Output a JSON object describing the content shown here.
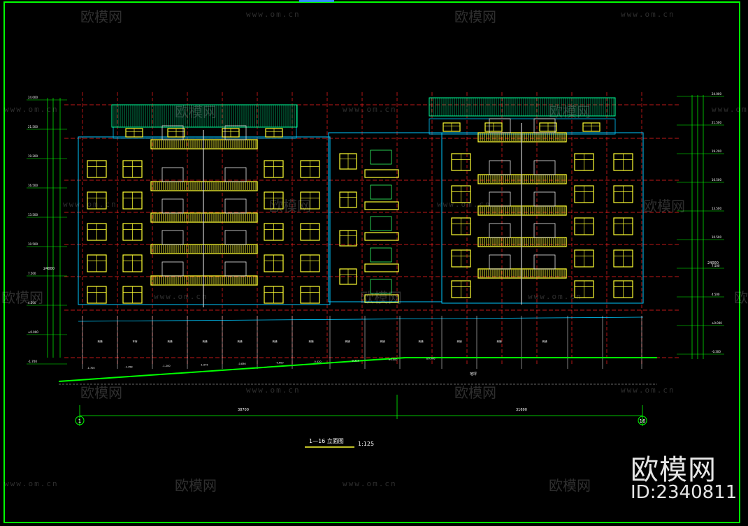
{
  "drawing": {
    "title": "1—16 立面图",
    "axis_start": "1",
    "axis_end": "16",
    "scale": "1:125",
    "total_length": "38700",
    "partial_length": "31690",
    "ground_label": "地坪",
    "left_total_height": "24000",
    "right_total_height": "24000",
    "left_levels": [
      "24.000",
      "21.500",
      "19.200",
      "16.500",
      "13.500",
      "10.500",
      "7.500",
      "4.500",
      "±0.000",
      "-1.700"
    ],
    "right_levels": [
      "24.000",
      "21.500",
      "19.200",
      "16.500",
      "13.500",
      "10.500",
      "7.500",
      "4.500",
      "±0.000",
      "-0.300"
    ],
    "ground_marks": [
      "-1.700",
      "-1.458",
      "-1.200",
      "-1.075",
      "-0.836",
      "-0.600",
      "-0.420",
      "-0.312",
      "±0.000",
      "±0.000"
    ],
    "shop_labels": [
      "商铺",
      "车库",
      "商铺",
      "商铺",
      "商铺",
      "商铺",
      "商铺",
      "商铺",
      "商铺",
      "商铺",
      "商铺",
      "商铺",
      "商铺"
    ]
  },
  "watermark": {
    "brand": "欧模网",
    "url": "www.om.cn",
    "big_brand": "欧模网",
    "id": "ID:2340811"
  },
  "colors": {
    "border": "#00ff00",
    "wall": "#00c8ff",
    "window": "#ffff33",
    "red_grid": "#ff2020",
    "roof": "#00ff9a",
    "ground": "#00ff00"
  }
}
